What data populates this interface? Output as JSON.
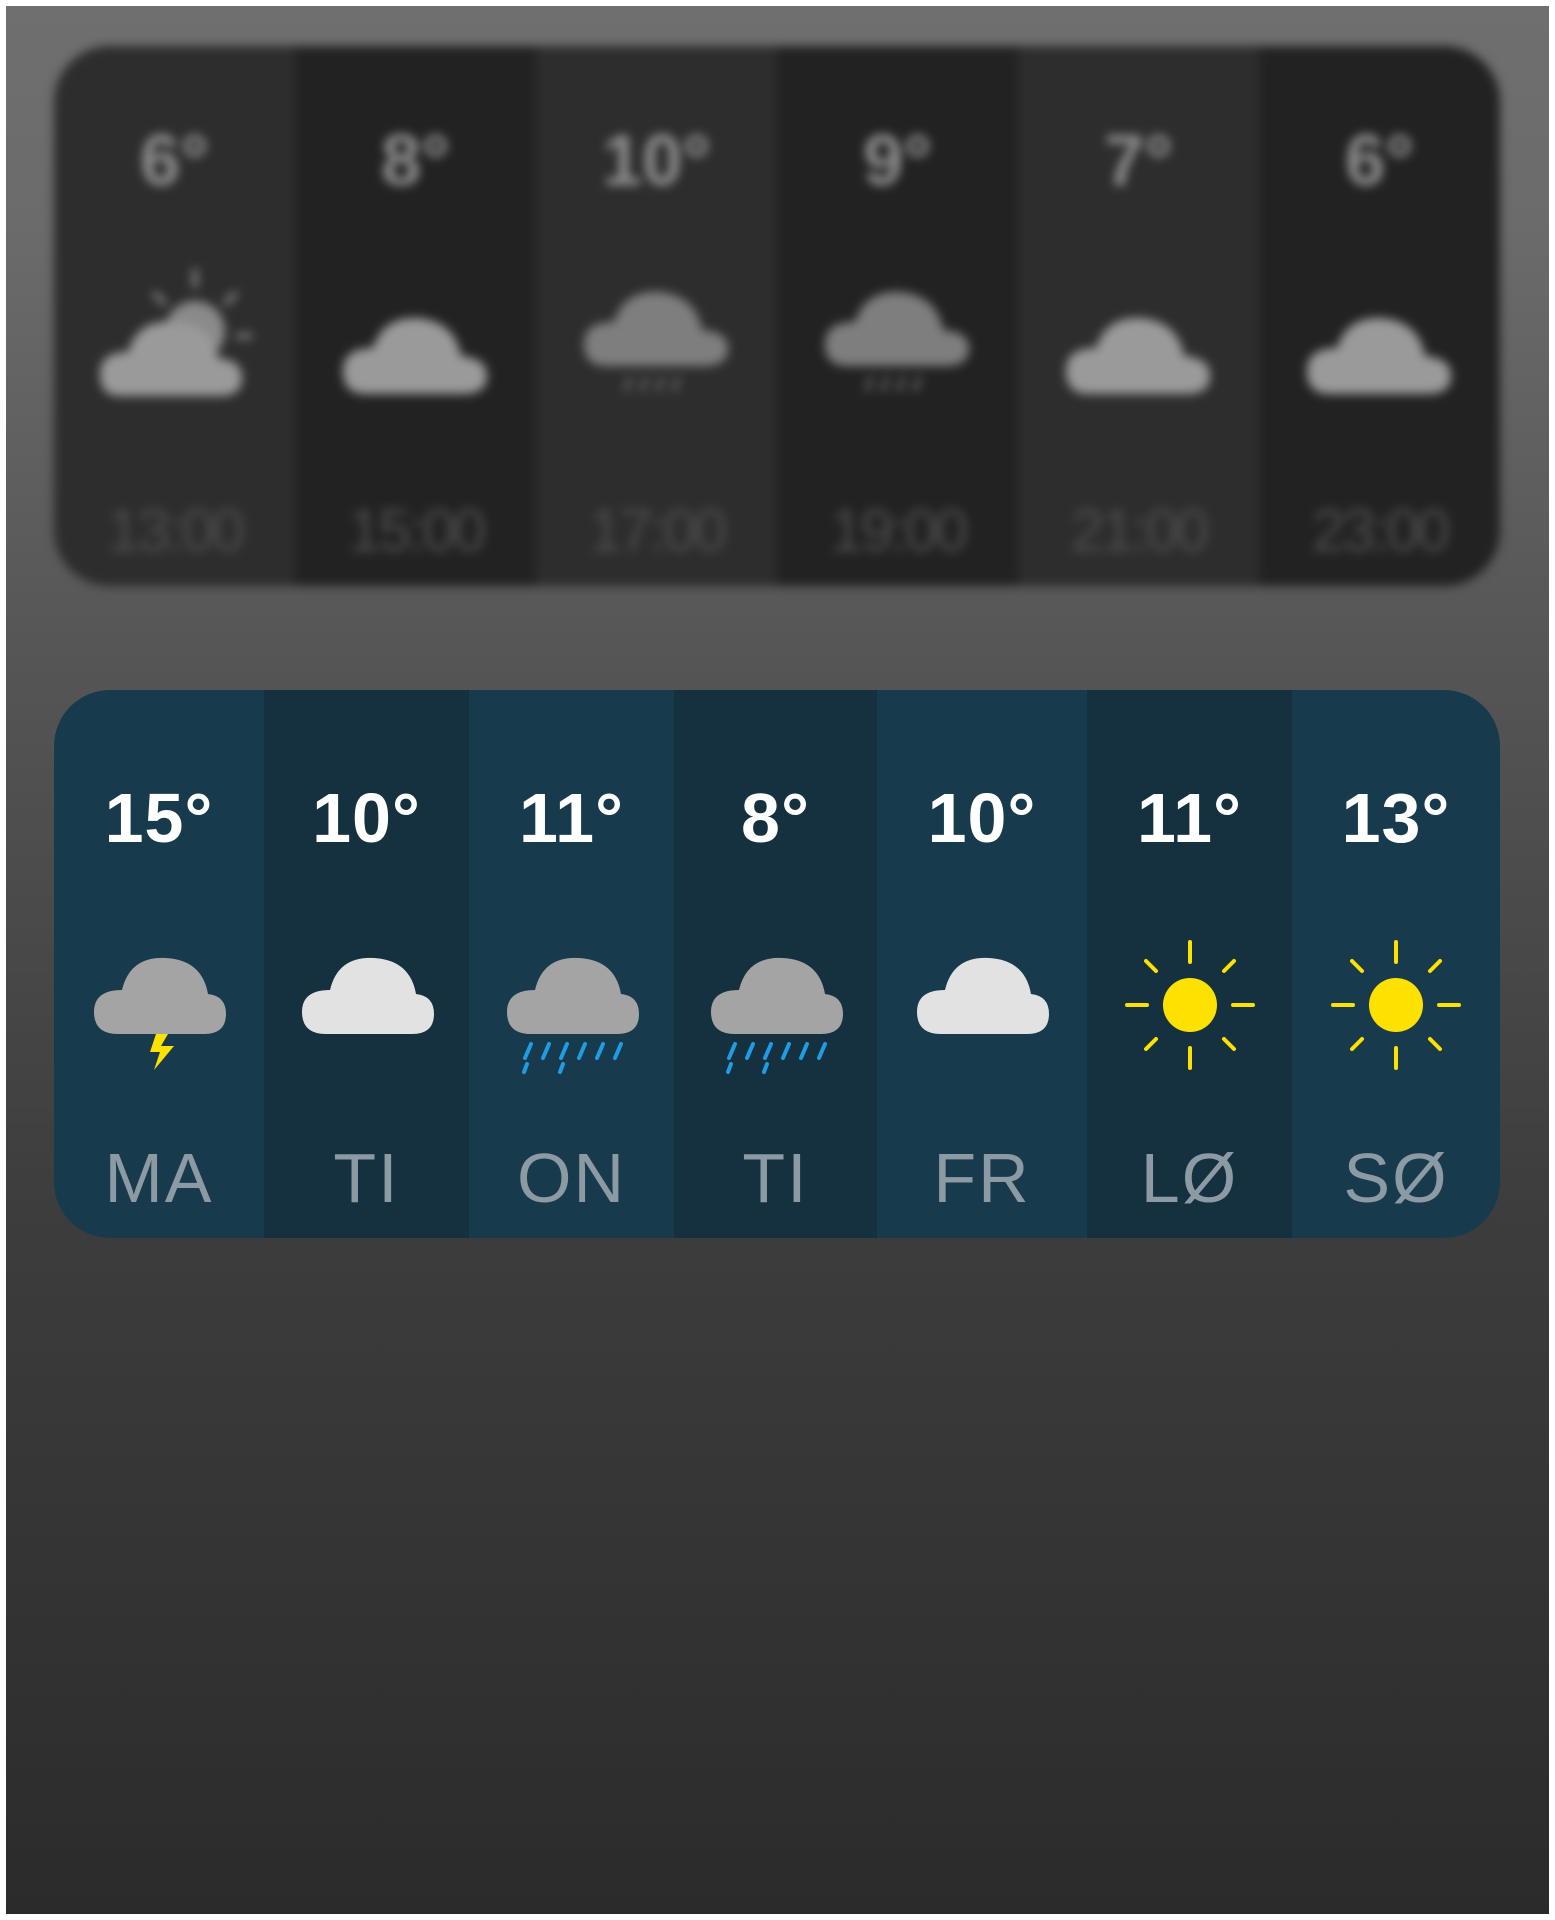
{
  "hourly_forecast": [
    {
      "temp": "6°",
      "time": "13:00",
      "icon": "partly-cloudy-icon"
    },
    {
      "temp": "8°",
      "time": "15:00",
      "icon": "cloud-icon"
    },
    {
      "temp": "10°",
      "time": "17:00",
      "icon": "light-rain-icon"
    },
    {
      "temp": "9°",
      "time": "19:00",
      "icon": "light-rain-icon"
    },
    {
      "temp": "7°",
      "time": "21:00",
      "icon": "cloud-icon"
    },
    {
      "temp": "6°",
      "time": "23:00",
      "icon": "cloud-icon"
    }
  ],
  "weekly_forecast": [
    {
      "day": "MA",
      "temp": "15°",
      "icon": "thunderstorm-icon"
    },
    {
      "day": "TI",
      "temp": "10°",
      "icon": "cloud-icon"
    },
    {
      "day": "ON",
      "temp": "11°",
      "icon": "rain-icon"
    },
    {
      "day": "TI",
      "temp": "8°",
      "icon": "rain-icon"
    },
    {
      "day": "FR",
      "temp": "10°",
      "icon": "cloud-icon"
    },
    {
      "day": "LØ",
      "temp": "11°",
      "icon": "sun-icon"
    },
    {
      "day": "SØ",
      "temp": "13°",
      "icon": "sun-icon"
    }
  ],
  "colors": {
    "weekly_column_light": "#183a4d",
    "weekly_column_dark": "#15303f",
    "sun": "#ffe100",
    "rain": "#1f9ce3",
    "cloud_light": "#e2e2e2",
    "cloud_dark": "#a4a4a4"
  }
}
